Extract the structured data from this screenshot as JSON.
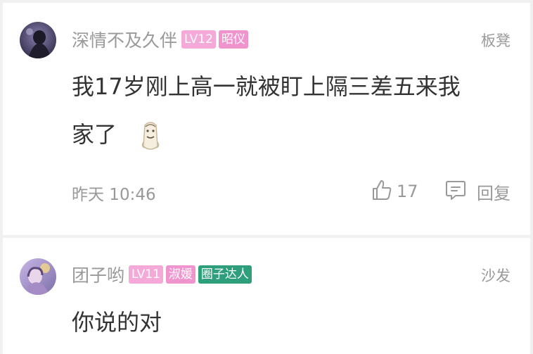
{
  "comments": [
    {
      "username": "深情不及久伴",
      "level_badge": "LV12",
      "title_badge": "昭仪",
      "floor": "板凳",
      "content_line1": "我17岁刚上高一就被盯上隔三差五来我",
      "content_line2": "家了",
      "sticker_icon": "meme-face-sticker",
      "time": "昨天 10:46",
      "like_count": "17",
      "reply_label": "回复"
    },
    {
      "username": "团子哟",
      "level_badge": "LV11",
      "title_badge": "淑媛",
      "group_badge": "圈子达人",
      "floor": "沙发",
      "content_line1": "你说的对"
    }
  ],
  "colors": {
    "level_badge": "#f4a9d8",
    "title_badge": "#f094cd",
    "group_badge": "#2f9e7b",
    "muted_text": "#999999",
    "body_text": "#333333"
  }
}
